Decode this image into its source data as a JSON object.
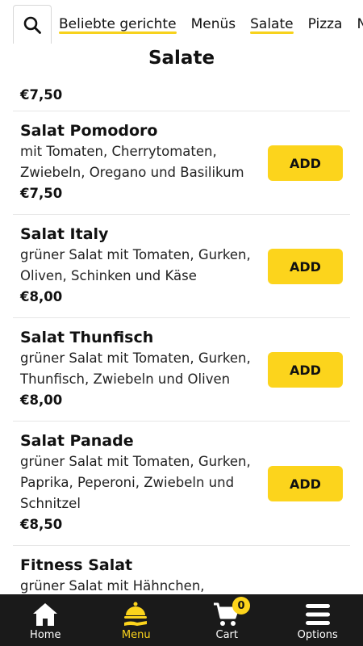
{
  "categories": {
    "tabs": [
      {
        "label": "Beliebte gerichte"
      },
      {
        "label": "Menüs"
      },
      {
        "label": "Salate"
      },
      {
        "label": "Pizza"
      },
      {
        "label": "N"
      }
    ]
  },
  "section": {
    "title": "Salate"
  },
  "partial_item": {
    "price": "€7,50"
  },
  "items": [
    {
      "name": "Salat Pomodoro",
      "description": "mit Tomaten, Cherrytomaten, Zwiebeln, Oregano und Basilikum",
      "price": "€7,50",
      "add_label": "ADD"
    },
    {
      "name": "Salat Italy",
      "description": "grüner Salat mit Tomaten, Gurken, Oliven, Schinken und Käse",
      "price": "€8,00",
      "add_label": "ADD"
    },
    {
      "name": "Salat Thunfisch",
      "description": "grüner Salat mit Tomaten, Gurken, Thunfisch, Zwiebeln und Oliven",
      "price": "€8,00",
      "add_label": "ADD"
    },
    {
      "name": "Salat Panade",
      "description": "grüner Salat mit Tomaten, Gurken, Paprika, Peperoni, Zwiebeln und Schnitzel",
      "price": "€8,50",
      "add_label": "ADD"
    },
    {
      "name": "Fitness Salat",
      "description": "grüner Salat mit Hähnchen,"
    }
  ],
  "nav": {
    "home": "Home",
    "menu": "Menu",
    "cart": "Cart",
    "cart_count": "0",
    "options": "Options"
  },
  "colors": {
    "accent": "#fcd41c",
    "nav_bg": "#1a1a1a"
  }
}
